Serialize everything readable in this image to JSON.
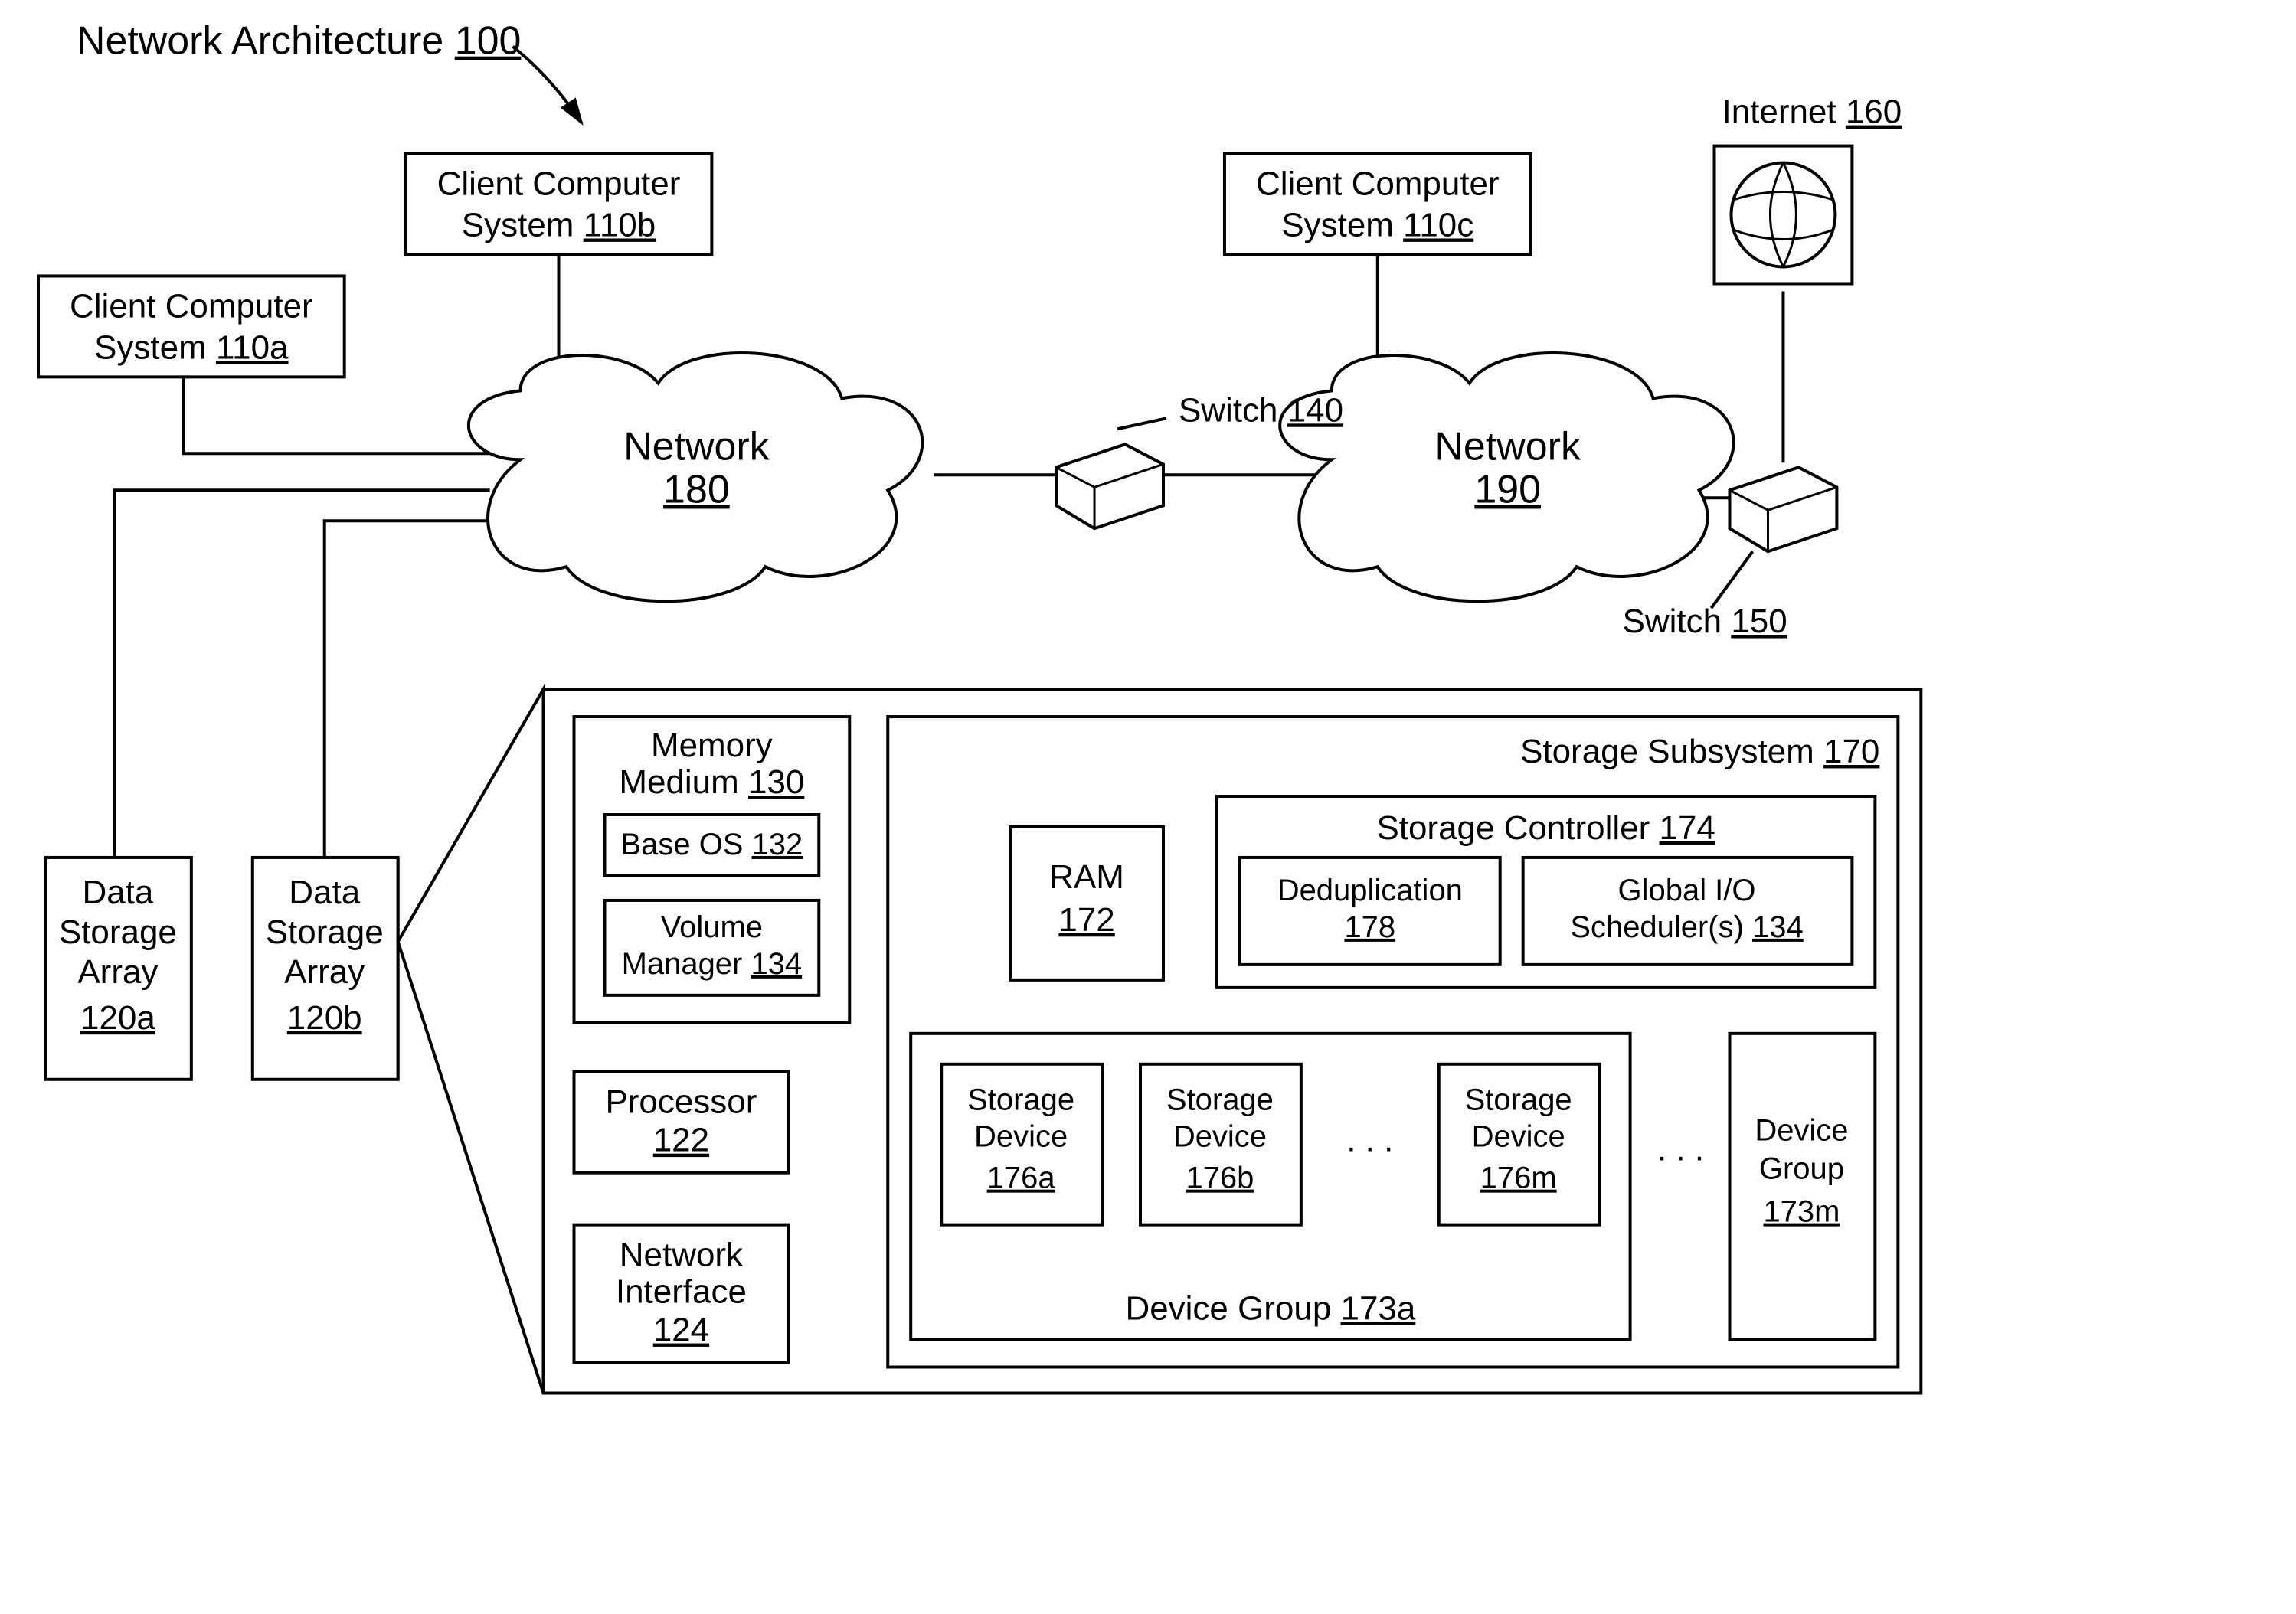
{
  "title": {
    "label": "Network Architecture",
    "num": "100"
  },
  "client_a": {
    "l1": "Client Computer",
    "l2": "System",
    "num": "110a"
  },
  "client_b": {
    "l1": "Client Computer",
    "l2": "System",
    "num": "110b"
  },
  "client_c": {
    "l1": "Client Computer",
    "l2": "System",
    "num": "110c"
  },
  "network180": {
    "label": "Network",
    "num": "180"
  },
  "network190": {
    "label": "Network",
    "num": "190"
  },
  "switch140": {
    "label": "Switch",
    "num": "140"
  },
  "switch150": {
    "label": "Switch",
    "num": "150"
  },
  "internet": {
    "label": "Internet",
    "num": "160"
  },
  "dsa_a": {
    "l1": "Data",
    "l2": "Storage",
    "l3": "Array",
    "num": "120a"
  },
  "dsa_b": {
    "l1": "Data",
    "l2": "Storage",
    "l3": "Array",
    "num": "120b"
  },
  "memory": {
    "l1": "Memory",
    "l2": "Medium",
    "num": "130"
  },
  "baseos": {
    "label": "Base OS",
    "num": "132"
  },
  "volmgr": {
    "l1": "Volume",
    "l2": "Manager",
    "num": "134"
  },
  "processor": {
    "label": "Processor",
    "num": "122"
  },
  "netif": {
    "l1": "Network",
    "l2": "Interface",
    "num": "124"
  },
  "subsystem": {
    "label": "Storage Subsystem",
    "num": "170"
  },
  "ram": {
    "label": "RAM",
    "num": "172"
  },
  "controller": {
    "label": "Storage Controller",
    "num": "174"
  },
  "dedup": {
    "label": "Deduplication",
    "num": "178"
  },
  "sched": {
    "l1": "Global I/O",
    "l2": "Scheduler(s)",
    "num": "134"
  },
  "sd_a": {
    "l1": "Storage",
    "l2": "Device",
    "num": "176a"
  },
  "sd_b": {
    "l1": "Storage",
    "l2": "Device",
    "num": "176b"
  },
  "sd_m": {
    "l1": "Storage",
    "l2": "Device",
    "num": "176m"
  },
  "dg_m": {
    "l1": "Device",
    "l2": "Group",
    "num": "173m"
  },
  "dg_a": {
    "label": "Device Group",
    "num": "173a"
  },
  "dots": ".   .   ."
}
